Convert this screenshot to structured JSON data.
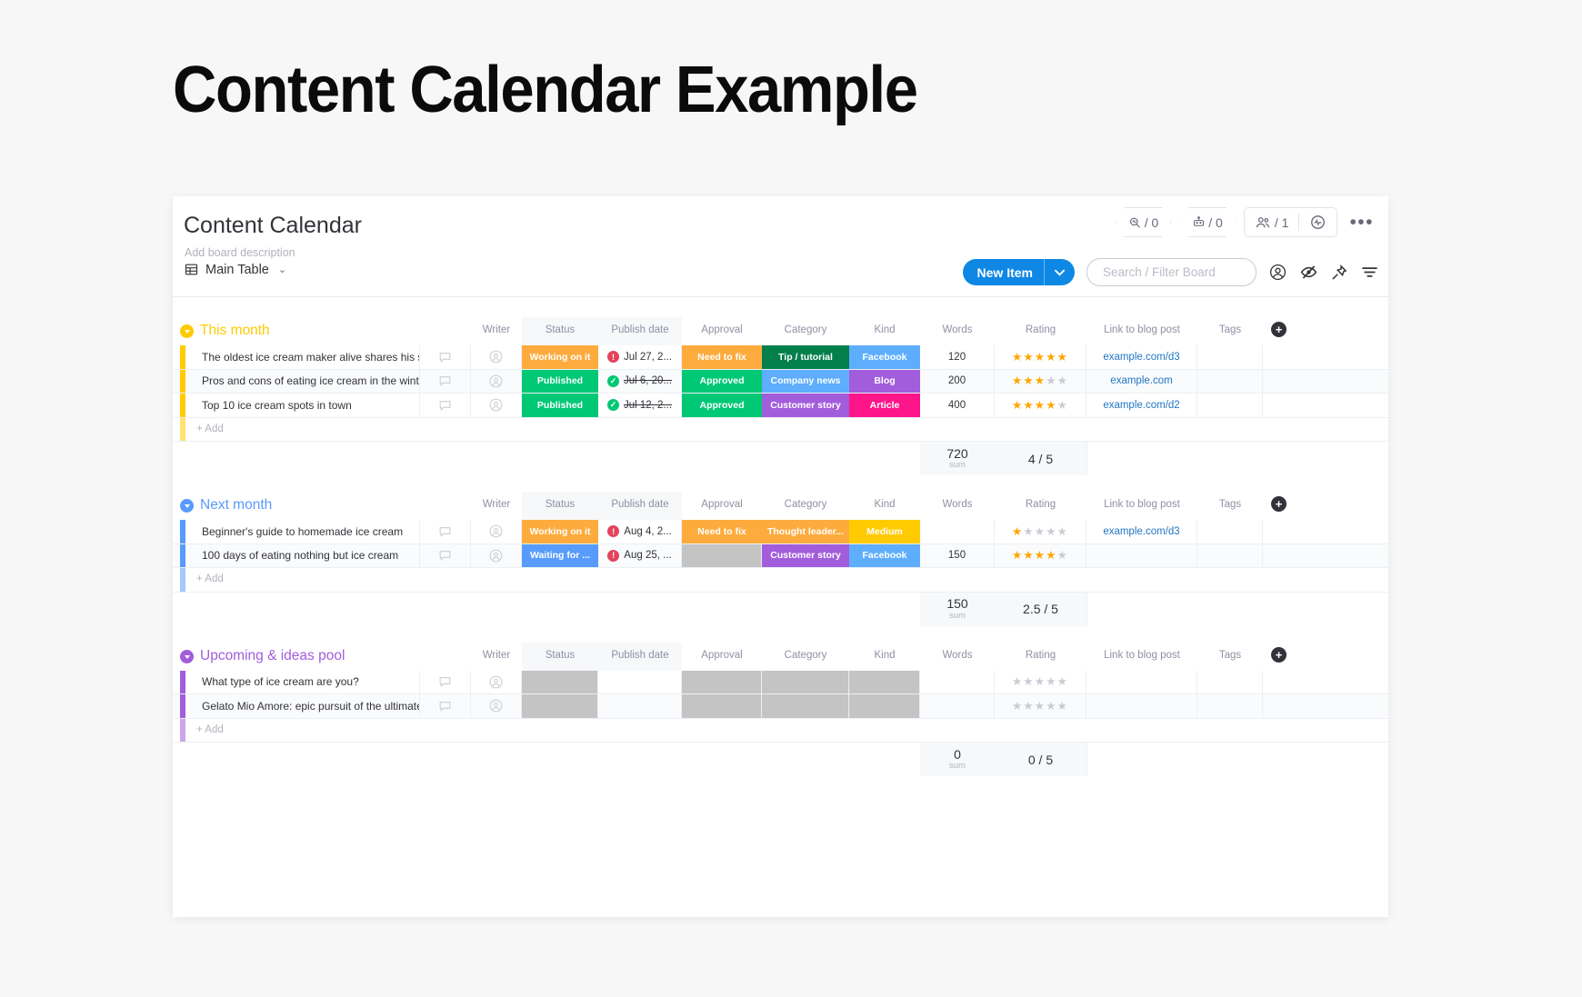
{
  "page": {
    "heading": "Content Calendar Example"
  },
  "board": {
    "name": "Content Calendar",
    "description": "Add board description",
    "chips": [
      {
        "name": "activity-log-chip",
        "icon": "magnifier-pulse-icon",
        "value": "/ 0"
      },
      {
        "name": "automations-chip",
        "icon": "robot-icon",
        "value": "/ 0"
      }
    ],
    "members": {
      "icon": "people-icon",
      "value": "/ 1"
    },
    "integrations_icon": "activity-circle-icon",
    "more_label": "•••"
  },
  "tabs": {
    "main_table": "Main Table",
    "chevron": "⌄"
  },
  "toolbar": {
    "new_item_label": "New Item",
    "new_item_chevron": "⌄",
    "search_placeholder": "Search / Filter Board",
    "search_value": "",
    "icons": [
      "person-circle-icon",
      "hide-eye-icon",
      "pin-icon",
      "filter-icon"
    ]
  },
  "columns": [
    "Writer",
    "Status",
    "Publish date",
    "Approval",
    "Category",
    "Kind",
    "Words",
    "Rating",
    "Link to blog post",
    "Tags"
  ],
  "add_label": "+ Add",
  "sum_label": "sum",
  "groups": [
    {
      "title": "This month",
      "color": "#ffcb00",
      "rows": [
        {
          "name": "The oldest ice cream maker alive shares his se...",
          "status": {
            "label": "Working on it",
            "color": "#fdab3d"
          },
          "date": {
            "text": "Jul 27, 2...",
            "strike": false,
            "marker": "alert",
            "marker_color": "#e2445c"
          },
          "approval": {
            "label": "Need to fix",
            "color": "#fdab3d"
          },
          "category": {
            "label": "Tip / tutorial",
            "color": "#037f4c"
          },
          "kind": {
            "label": "Facebook",
            "color": "#5eaefd"
          },
          "words": "120",
          "rating": 5,
          "link": "example.com/d3",
          "tags": ""
        },
        {
          "name": "Pros and cons of eating ice cream in the winter",
          "status": {
            "label": "Published",
            "color": "#00c875"
          },
          "date": {
            "text": "Jul 6, 20...",
            "strike": true,
            "marker": "check",
            "marker_color": "#00c875"
          },
          "approval": {
            "label": "Approved",
            "color": "#00c875"
          },
          "category": {
            "label": "Company news",
            "color": "#5eaefd"
          },
          "kind": {
            "label": "Blog",
            "color": "#a25ddc"
          },
          "words": "200",
          "rating": 3,
          "link": "example.com",
          "tags": ""
        },
        {
          "name": "Top 10 ice cream spots in town",
          "status": {
            "label": "Published",
            "color": "#00c875"
          },
          "date": {
            "text": "Jul 12, 2...",
            "strike": true,
            "marker": "check",
            "marker_color": "#00c875"
          },
          "approval": {
            "label": "Approved",
            "color": "#00c875"
          },
          "category": {
            "label": "Customer story",
            "color": "#a25ddc"
          },
          "kind": {
            "label": "Article",
            "color": "#ff158a"
          },
          "words": "400",
          "rating": 4,
          "link": "example.com/d2",
          "tags": ""
        }
      ],
      "summary": {
        "words": "720",
        "rating": "4 / 5"
      }
    },
    {
      "title": "Next month",
      "color": "#579bfc",
      "rows": [
        {
          "name": "Beginner's guide to homemade ice cream",
          "status": {
            "label": "Working on it",
            "color": "#fdab3d"
          },
          "date": {
            "text": "Aug 4, 2...",
            "strike": false,
            "marker": "alert",
            "marker_color": "#e2445c"
          },
          "approval": {
            "label": "Need to fix",
            "color": "#fdab3d"
          },
          "category": {
            "label": "Thought leader...",
            "color": "#fdab3d"
          },
          "kind": {
            "label": "Medium",
            "color": "#ffcb00"
          },
          "words": "",
          "rating": 1,
          "link": "example.com/d3",
          "tags": ""
        },
        {
          "name": "100 days of eating nothing but ice cream",
          "status": {
            "label": "Waiting for ...",
            "color": "#579bfc"
          },
          "date": {
            "text": "Aug 25, ...",
            "strike": false,
            "marker": "alert",
            "marker_color": "#e2445c"
          },
          "approval": {
            "label": "",
            "color": "#c4c4c4"
          },
          "category": {
            "label": "Customer story",
            "color": "#a25ddc"
          },
          "kind": {
            "label": "Facebook",
            "color": "#5eaefd"
          },
          "words": "150",
          "rating": 4,
          "link": "",
          "tags": ""
        }
      ],
      "summary": {
        "words": "150",
        "rating": "2.5 / 5"
      }
    },
    {
      "title": "Upcoming & ideas pool",
      "color": "#a25ddc",
      "rows": [
        {
          "name": "What type of ice cream are you?",
          "status": {
            "label": "",
            "color": "#c4c4c4"
          },
          "date": {
            "text": "",
            "strike": false,
            "marker": "",
            "marker_color": ""
          },
          "approval": {
            "label": "",
            "color": "#c4c4c4"
          },
          "category": {
            "label": "",
            "color": "#c4c4c4"
          },
          "kind": {
            "label": "",
            "color": "#c4c4c4"
          },
          "words": "",
          "rating": 0,
          "link": "",
          "tags": ""
        },
        {
          "name": "Gelato Mio Amore: epic pursuit of the ultimate i...",
          "status": {
            "label": "",
            "color": "#c4c4c4"
          },
          "date": {
            "text": "",
            "strike": false,
            "marker": "",
            "marker_color": ""
          },
          "approval": {
            "label": "",
            "color": "#c4c4c4"
          },
          "category": {
            "label": "",
            "color": "#c4c4c4"
          },
          "kind": {
            "label": "",
            "color": "#c4c4c4"
          },
          "words": "",
          "rating": 0,
          "link": "",
          "tags": ""
        }
      ],
      "summary": {
        "words": "0",
        "rating": "0 / 5"
      }
    }
  ]
}
